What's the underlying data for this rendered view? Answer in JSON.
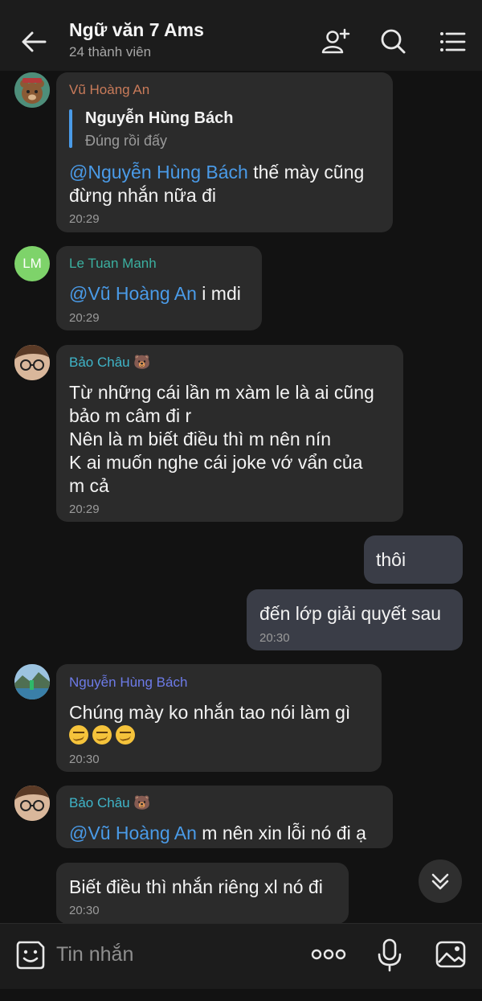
{
  "header": {
    "title": "Ngữ văn 7 Ams",
    "subtitle": "24 thành viên"
  },
  "messages": [
    {
      "sender": "Vũ Hoàng An",
      "reply": {
        "name": "Nguyễn Hùng Bách",
        "text": "Đúng rồi đấy"
      },
      "mention": "@Nguyễn Hùng Bách",
      "line1": " thế mày cũng",
      "line2": "đừng nhắn nữa đi",
      "time": "20:29"
    },
    {
      "sender": "Le Tuan Manh",
      "avatar_initials": "LM",
      "mention": "@Vũ Hoàng An",
      "text": " i mdi",
      "time": "20:29"
    },
    {
      "sender": "Bảo Châu 🐻",
      "lines": [
        "Từ những cái lần m xàm le là ai cũng",
        "bảo m câm đi r",
        "Nên là m biết điều thì m nên nín",
        "K ai muốn nghe cái joke vớ vẩn của",
        "m cả"
      ],
      "time": "20:29"
    },
    {
      "text": "thôi"
    },
    {
      "text": "đến lớp giải quyết sau",
      "time": "20:30"
    },
    {
      "sender": "Nguyễn Hùng Bách",
      "line1": "Chúng mày ko nhắn tao nói làm gì",
      "time": "20:30"
    },
    {
      "sender": "Bảo Châu 🐻",
      "mention": "@Vũ Hoàng An",
      "text": " m nên xin lỗi nó đi ạ"
    },
    {
      "text": "Biết điều thì nhắn riêng xl nó đi",
      "time": "20:30"
    }
  ],
  "composer": {
    "placeholder": "Tin nhắn"
  },
  "colors": {
    "accent": "#4a9be8",
    "sender_an": "#c97b5a",
    "sender_manh": "#3bb0a0",
    "sender_chau": "#3fb5c9",
    "sender_bach": "#6d7be8"
  }
}
